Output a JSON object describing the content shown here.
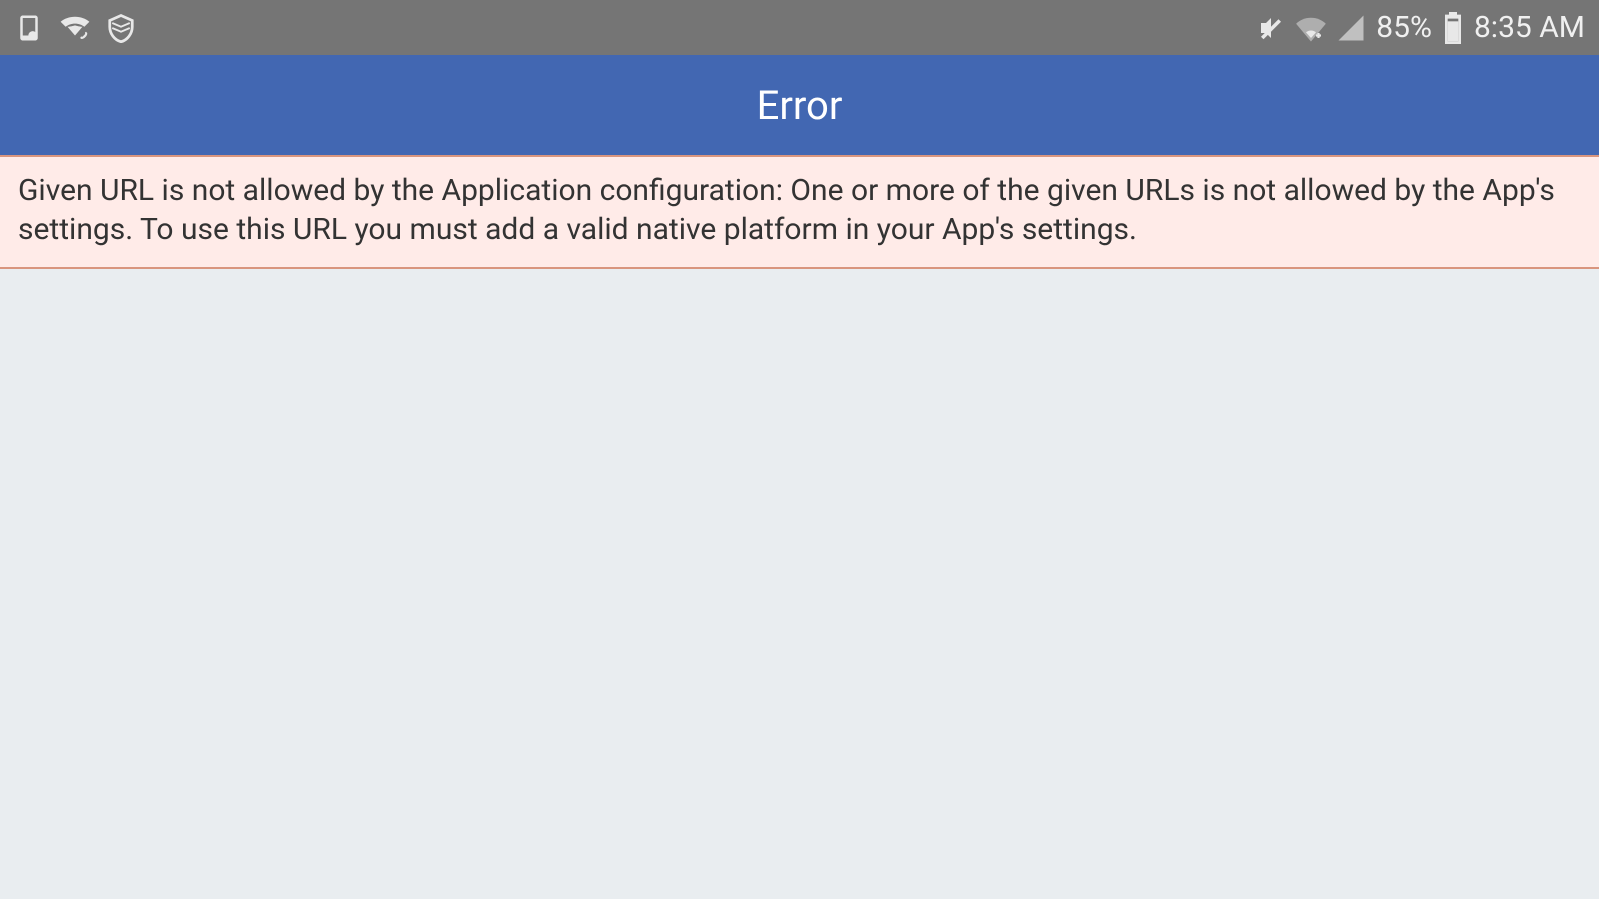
{
  "statusBar": {
    "battery": "85%",
    "time": "8:35 AM"
  },
  "titleBar": {
    "title": "Error"
  },
  "errorBanner": {
    "message": "Given URL is not allowed by the Application configuration: One or more of the given URLs is not allowed by the App's settings. To use this URL you must add a valid native platform in your App's settings."
  }
}
